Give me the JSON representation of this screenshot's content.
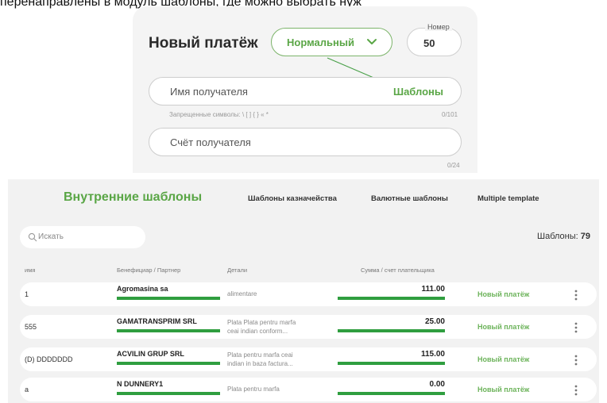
{
  "caption": "перенаправлены в модуль шаблоны, где можно выбрать нуж",
  "form": {
    "title": "Новый платёж",
    "payment_type": "Нормальный",
    "number_label": "Номер",
    "number_value": "50",
    "recipient_name_placeholder": "Имя получателя",
    "templates_link": "Шаблоны",
    "forbidden_chars_hint": "Запрещенные символы: \\ [ ] { } « *",
    "recipient_name_counter": "0/101",
    "recipient_account_placeholder": "Счёт получателя",
    "recipient_account_counter": "0/24"
  },
  "templates": {
    "tabs": {
      "internal": "Внутренние шаблоны",
      "treasury": "Шаблоны казначейства",
      "currency": "Валютные шаблоны",
      "multiple": "Multiple template"
    },
    "search_placeholder": "Искать",
    "count_label": "Шаблоны:",
    "count_value": "79",
    "columns": {
      "name": "имя",
      "beneficiary": "Бенефициар / Партнер",
      "details": "Детали",
      "amount": "Сумма / счет плательщика"
    },
    "rows": [
      {
        "name": "1",
        "beneficiary": "Agromasina sa",
        "details_line1": "alimentare",
        "details_line2": "",
        "amount": "111.00",
        "action": "Новый платёж"
      },
      {
        "name": "555",
        "beneficiary": "GAMATRANSPRIM SRL",
        "details_line1": "Plata Plata pentru marfa",
        "details_line2": "ceai indian conform...",
        "amount": "25.00",
        "action": "Новый платёж"
      },
      {
        "name": "(D) DDDDDDD",
        "beneficiary": "ACVILIN GRUP SRL",
        "details_line1": "Plata pentru marfa ceai",
        "details_line2": "indian in baza factura...",
        "amount": "115.00",
        "action": "Новый платёж"
      },
      {
        "name": "a",
        "beneficiary": "N DUNNERY1",
        "details_line1": "Plata pentru marfa",
        "details_line2": "",
        "amount": "0.00",
        "action": "Новый платёж"
      }
    ]
  },
  "colors": {
    "accent_green": "#5aa646",
    "mask_green": "#2f9e3f",
    "panel_bg": "#f2f2f2"
  }
}
